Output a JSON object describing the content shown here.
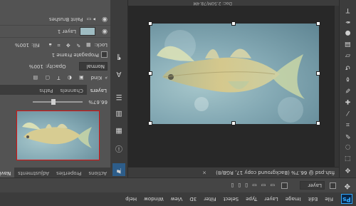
{
  "menu": {
    "logo": "Ps",
    "items": [
      "File",
      "Edit",
      "Image",
      "Layer",
      "Type",
      "Select",
      "Filter",
      "3D",
      "View",
      "Window",
      "Help"
    ]
  },
  "options": {
    "autoselect_label": "Layer",
    "show_transform": "",
    "icons": [
      "move-tool-icon"
    ]
  },
  "document": {
    "tab_title": "fish.psd @ 66.7% (Background copy 17, RGB/8)",
    "close": "×",
    "status": "Doc: 2.50M/78.4M"
  },
  "panels": {
    "top_tabs": [
      "Actions",
      "Properties",
      "Adjustments",
      "Navigator"
    ],
    "zoom": "66.67%",
    "layer_tabs": [
      "Layers",
      "Channels",
      "Paths"
    ],
    "kind_label": "Kind",
    "blend_mode": "Normal",
    "opacity_label": "Opacity:",
    "opacity_value": "100%",
    "propagate_label": "Propagate Frame 1",
    "lock_label": "Lock:",
    "fill_label": "Fill:",
    "fill_value": "100%",
    "layers": [
      {
        "name": "Layer 1"
      },
      {
        "name": "Paint Brushes"
      }
    ]
  }
}
